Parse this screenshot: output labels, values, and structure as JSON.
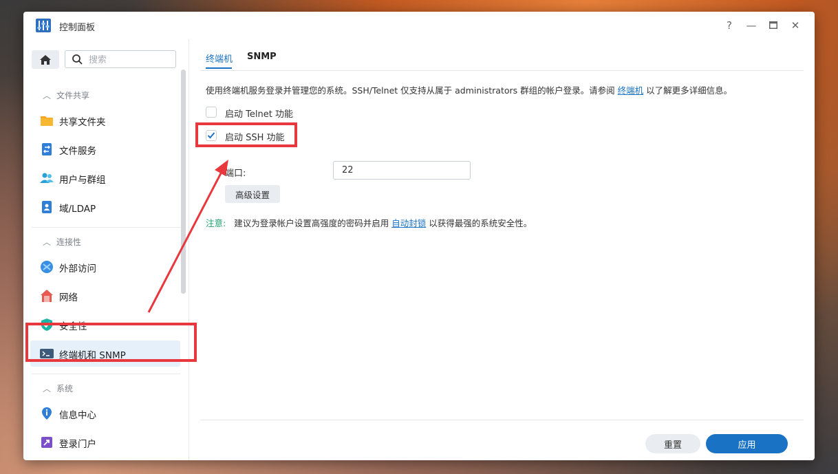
{
  "window": {
    "title": "控制面板",
    "controls": {
      "help": "?",
      "minimize": "—",
      "maximize": "▭",
      "close": "✕"
    }
  },
  "sidebar": {
    "search_placeholder": "搜索",
    "sections": [
      {
        "label": "文件共享",
        "items": [
          {
            "label": "共享文件夹",
            "icon": "folder-icon"
          },
          {
            "label": "文件服务",
            "icon": "file-service-icon"
          },
          {
            "label": "用户与群组",
            "icon": "users-icon"
          },
          {
            "label": "域/LDAP",
            "icon": "domain-ldap-icon"
          }
        ]
      },
      {
        "label": "连接性",
        "items": [
          {
            "label": "外部访问",
            "icon": "external-access-icon"
          },
          {
            "label": "网络",
            "icon": "network-house-icon"
          },
          {
            "label": "安全性",
            "icon": "shield-icon"
          },
          {
            "label": "终端机和 SNMP",
            "icon": "terminal-icon",
            "active": true
          }
        ]
      },
      {
        "label": "系统",
        "items": [
          {
            "label": "信息中心",
            "icon": "info-icon"
          },
          {
            "label": "登录门户",
            "icon": "login-portal-icon"
          }
        ]
      }
    ]
  },
  "tabs": [
    {
      "label": "终端机",
      "active": true
    },
    {
      "label": "SNMP",
      "active": false
    }
  ],
  "content": {
    "description_prefix": "使用终端机服务登录并管理您的系统。SSH/Telnet 仅支持从属于 administrators 群组的帐户登录。请参阅 ",
    "description_link": "终端机",
    "description_suffix": " 以了解更多详细信息。",
    "telnet_label": "启动 Telnet 功能",
    "telnet_checked": false,
    "ssh_label": "启动 SSH 功能",
    "ssh_checked": true,
    "port_label": "端口:",
    "port_value": "22",
    "advanced_button": "高级设置",
    "note_label": "注意:",
    "note_prefix": "建议为登录帐户设置高强度的密码并启用 ",
    "note_link": "自动封锁",
    "note_suffix": " 以获得最强的系统安全性。"
  },
  "footer": {
    "reset": "重置",
    "apply": "应用"
  },
  "colors": {
    "accent": "#1a72c4",
    "annotation": "#e8383d",
    "note": "#1aa06a"
  }
}
